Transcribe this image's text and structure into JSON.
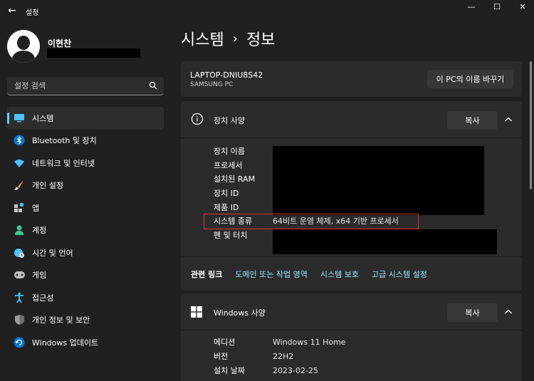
{
  "window": {
    "title": "설정",
    "back_icon": "←",
    "minimize_icon": "—",
    "maximize_icon": "☐",
    "close_icon": "✕"
  },
  "user": {
    "name": "이현찬"
  },
  "search": {
    "placeholder": "설정 검색"
  },
  "sidebar": {
    "items": [
      {
        "label": "시스템",
        "icon": "system-icon",
        "active": true
      },
      {
        "label": "Bluetooth 및 장치",
        "icon": "bluetooth-icon"
      },
      {
        "label": "네트워크 및 인터넷",
        "icon": "wifi-icon"
      },
      {
        "label": "개인 설정",
        "icon": "brush-icon"
      },
      {
        "label": "앱",
        "icon": "apps-icon"
      },
      {
        "label": "계정",
        "icon": "account-icon"
      },
      {
        "label": "시간 및 언어",
        "icon": "globe-clock-icon"
      },
      {
        "label": "게임",
        "icon": "gamepad-icon"
      },
      {
        "label": "접근성",
        "icon": "accessibility-icon"
      },
      {
        "label": "개인 정보 및 보안",
        "icon": "shield-icon"
      },
      {
        "label": "Windows 업데이트",
        "icon": "update-icon"
      }
    ]
  },
  "breadcrumb": {
    "parent": "시스템",
    "separator": "›",
    "current": "정보"
  },
  "device": {
    "name": "LAPTOP-DNIU8S42",
    "model": "SAMSUNG PC",
    "rename_label": "이 PC의 이름 바꾸기"
  },
  "device_specs": {
    "title": "장치 사양",
    "copy_label": "복사",
    "rows": [
      {
        "label": "장치 이름",
        "value": ""
      },
      {
        "label": "프로세서",
        "value": ""
      },
      {
        "label": "설치된 RAM",
        "value": ""
      },
      {
        "label": "장치 ID",
        "value": ""
      },
      {
        "label": "제품 ID",
        "value": ""
      },
      {
        "label": "시스템 종류",
        "value": "64비트 운영 체제, x64 기반 프로세서"
      },
      {
        "label": "펜 및 터치",
        "value": ""
      }
    ]
  },
  "related": {
    "title": "관련 링크",
    "links": [
      "도메인 또는 작업 영역",
      "시스템 보호",
      "고급 시스템 설정"
    ]
  },
  "windows_specs": {
    "title": "Windows 사양",
    "copy_label": "복사",
    "rows": [
      {
        "label": "에디션",
        "value": "Windows 11 Home"
      },
      {
        "label": "버전",
        "value": "22H2"
      },
      {
        "label": "설치 날짜",
        "value": "2023-02-25"
      }
    ]
  },
  "colors": {
    "accent": "#60cdff",
    "link": "#99ebff",
    "highlight": "#e0332b",
    "background": "#202020",
    "card": "#2b2b2b"
  }
}
